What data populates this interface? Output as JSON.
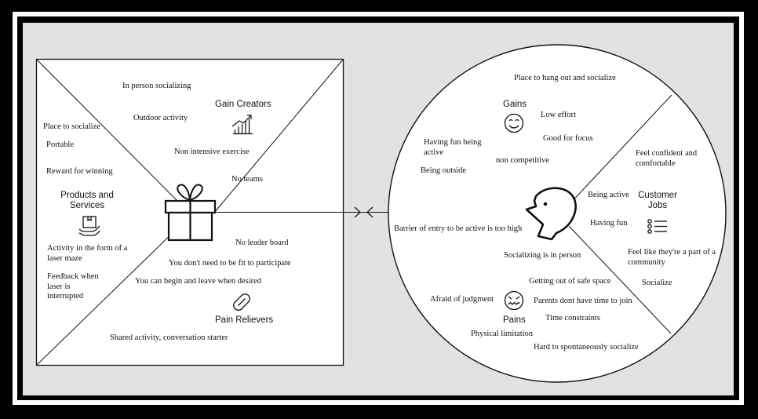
{
  "value_map": {
    "gain_creators": {
      "title": "Gain Creators",
      "icon": "growth-chart-icon",
      "items": [
        "In person socializing",
        "Outdoor activity",
        "Non intensive exercise",
        "No teams"
      ]
    },
    "products_services": {
      "title": "Products and Services",
      "icon": "hand-box-icon",
      "items": [
        "Place to socialize",
        "Portable",
        "Reward for winning",
        "Activity in the form of a laser maze",
        "Feedback when laser is interrupted"
      ]
    },
    "pain_relievers": {
      "title": "Pain Relievers",
      "icon": "pill-icon",
      "items": [
        "No leader board",
        "You don't need to be fit to participate",
        "You can begin and leave when desired",
        "Shared activity, conversation starter"
      ]
    },
    "center_icon": "gift-icon"
  },
  "customer_profile": {
    "gains": {
      "title": "Gains",
      "icon": "smiley-face-icon",
      "items": [
        "Place to hang out and socialize",
        "Low effort",
        "Good for focus",
        "Having fun being active",
        "Being outside",
        "non competitive"
      ]
    },
    "customer_jobs": {
      "title": "Customer Jobs",
      "icon": "list-icon",
      "items": [
        "Feel confident and comfortable",
        "Being active",
        "Having fun",
        "Feel like they're a part of a community",
        "Socialize"
      ]
    },
    "pains": {
      "title": "Pains",
      "icon": "distressed-face-icon",
      "items": [
        "Barrier of entry to be active is too high",
        "Socializing is in person",
        "Getting out of safe space",
        "Afraid of judgment",
        "Parents dont have time to join",
        "Time constraints",
        "Physical limitation",
        "Hard to spontaneously socialize"
      ]
    },
    "center_icon": "person-head-icon"
  },
  "connector": {
    "icon": "double-arrow-icon"
  }
}
